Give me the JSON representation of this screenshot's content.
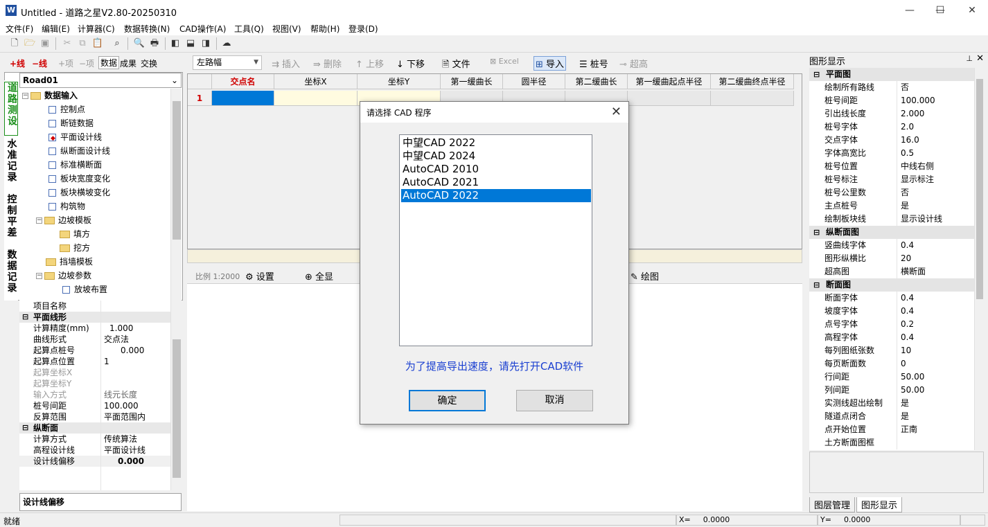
{
  "window": {
    "title": "Untitled - 道路之星V2.80-20250310",
    "app_icon": "app-logo-icon"
  },
  "menu": [
    "文件(F)",
    "编辑(E)",
    "计算器(C)",
    "数据转换(N)",
    "CAD操作(A)",
    "工具(Q)",
    "视图(V)",
    "帮助(H)",
    "登录(D)"
  ],
  "left": {
    "tabs": {
      "add_line": "+线",
      "del_line": "−线",
      "add_item": "+项",
      "del_item": "−项",
      "data": "数据",
      "result": "成果",
      "exchange": "交换"
    },
    "road": "Road01",
    "vertical_tabs": [
      "道路测设",
      "水准记录",
      "控制平差",
      "数据记录"
    ],
    "tree": {
      "root": "数据输入",
      "items": [
        "控制点",
        "断链数据",
        "平面设计线",
        "纵断面设计线",
        "标准横断面",
        "板块宽度变化",
        "板块横坡变化",
        "构筑物"
      ],
      "slope_template": "边坡模板",
      "slope_children": [
        "填方",
        "挖方"
      ],
      "wall_template": "挡墙模板",
      "slope_params": "边坡参数",
      "slope_params_child": "放坡布置"
    },
    "props": {
      "project_name": "项目名称",
      "cat_plane": "平面线形",
      "rows1": [
        {
          "k": "计算精度(mm)",
          "v": "1.000"
        },
        {
          "k": "曲线形式",
          "v": "交点法"
        },
        {
          "k": "起算点桩号",
          "v": "0.000"
        },
        {
          "k": "起算点位置",
          "v": "1"
        },
        {
          "k": "起算坐标X",
          "v": ""
        },
        {
          "k": "起算坐标Y",
          "v": ""
        },
        {
          "k": "输入方式",
          "v": "线元长度"
        },
        {
          "k": "桩号间距",
          "v": "100.000"
        },
        {
          "k": "反算范围",
          "v": "平面范围内"
        }
      ],
      "cat_profile": "纵断面",
      "rows2": [
        {
          "k": "计算方式",
          "v": "传统算法"
        },
        {
          "k": "高程设计线",
          "v": "平面设计线"
        },
        {
          "k": "设计线偏移",
          "v": "0.000"
        }
      ],
      "desc_title": "设计线偏移"
    }
  },
  "grid": {
    "toolbar": {
      "combo": "左路幅",
      "insert": "插入",
      "delete": "删除",
      "up": "上移",
      "down": "下移",
      "file": "文件",
      "excel": "Excel",
      "import": "导入",
      "station": "桩号",
      "super": "超高"
    },
    "columns": [
      "交点名",
      "坐标X",
      "坐标Y",
      "第一缓曲长",
      "圆半径",
      "第二缓曲长",
      "第一缓曲起点半径",
      "第二缓曲终点半径"
    ],
    "row_number": "1"
  },
  "draw": {
    "scale": "比例 1:2000",
    "settings": "设置",
    "full": "全显",
    "draw": "绘图"
  },
  "right": {
    "header": "图形显示",
    "cat_plane": "平面图",
    "plane": [
      {
        "k": "绘制所有路线",
        "v": "否"
      },
      {
        "k": "桩号间距",
        "v": "100.000"
      },
      {
        "k": "引出线长度",
        "v": "2.000"
      },
      {
        "k": "桩号字体",
        "v": "2.0"
      },
      {
        "k": "交点字体",
        "v": "16.0"
      },
      {
        "k": "字体高宽比",
        "v": "0.5"
      },
      {
        "k": "桩号位置",
        "v": "中线右侧"
      },
      {
        "k": "桩号标注",
        "v": "显示标注"
      },
      {
        "k": "桩号公里数",
        "v": "否"
      },
      {
        "k": "主点桩号",
        "v": "是"
      },
      {
        "k": "绘制板块线",
        "v": "显示设计线"
      }
    ],
    "cat_profile": "纵断面图",
    "profile": [
      {
        "k": "竖曲线字体",
        "v": "0.4"
      },
      {
        "k": "图形纵横比",
        "v": "20"
      },
      {
        "k": "超高图",
        "v": "横断面"
      }
    ],
    "cat_section": "断面图",
    "section": [
      {
        "k": "断面字体",
        "v": "0.4"
      },
      {
        "k": "坡度字体",
        "v": "0.4"
      },
      {
        "k": "点号字体",
        "v": "0.2"
      },
      {
        "k": "高程字体",
        "v": "0.4"
      },
      {
        "k": "每列图纸张数",
        "v": "10"
      },
      {
        "k": "每页断面数",
        "v": "0"
      },
      {
        "k": "行间距",
        "v": "50.00"
      },
      {
        "k": "列间距",
        "v": "50.00"
      },
      {
        "k": "实测线超出绘制",
        "v": "是"
      },
      {
        "k": "隧道点闭合",
        "v": "是"
      },
      {
        "k": "点开始位置",
        "v": "正南"
      },
      {
        "k": "土方断面图框",
        "v": ""
      }
    ],
    "tabs": [
      "图层管理",
      "图形显示"
    ]
  },
  "status": {
    "ready": "就绪",
    "x_label": "X=",
    "x_value": "0.0000",
    "y_label": "Y=",
    "y_value": "0.0000"
  },
  "dialog": {
    "title": "请选择 CAD 程序",
    "options": [
      "中望CAD 2022",
      "中望CAD 2024",
      "AutoCAD 2010",
      "AutoCAD 2021",
      "AutoCAD 2022"
    ],
    "selected": "AutoCAD 2022",
    "hint": "为了提高导出速度，请先打开CAD软件",
    "ok": "确定",
    "cancel": "取消"
  },
  "colors": {
    "accent": "#0078d7",
    "hint": "#1a3fd1",
    "header_red": "#d00000",
    "vtab_green": "#1a8f1a"
  }
}
